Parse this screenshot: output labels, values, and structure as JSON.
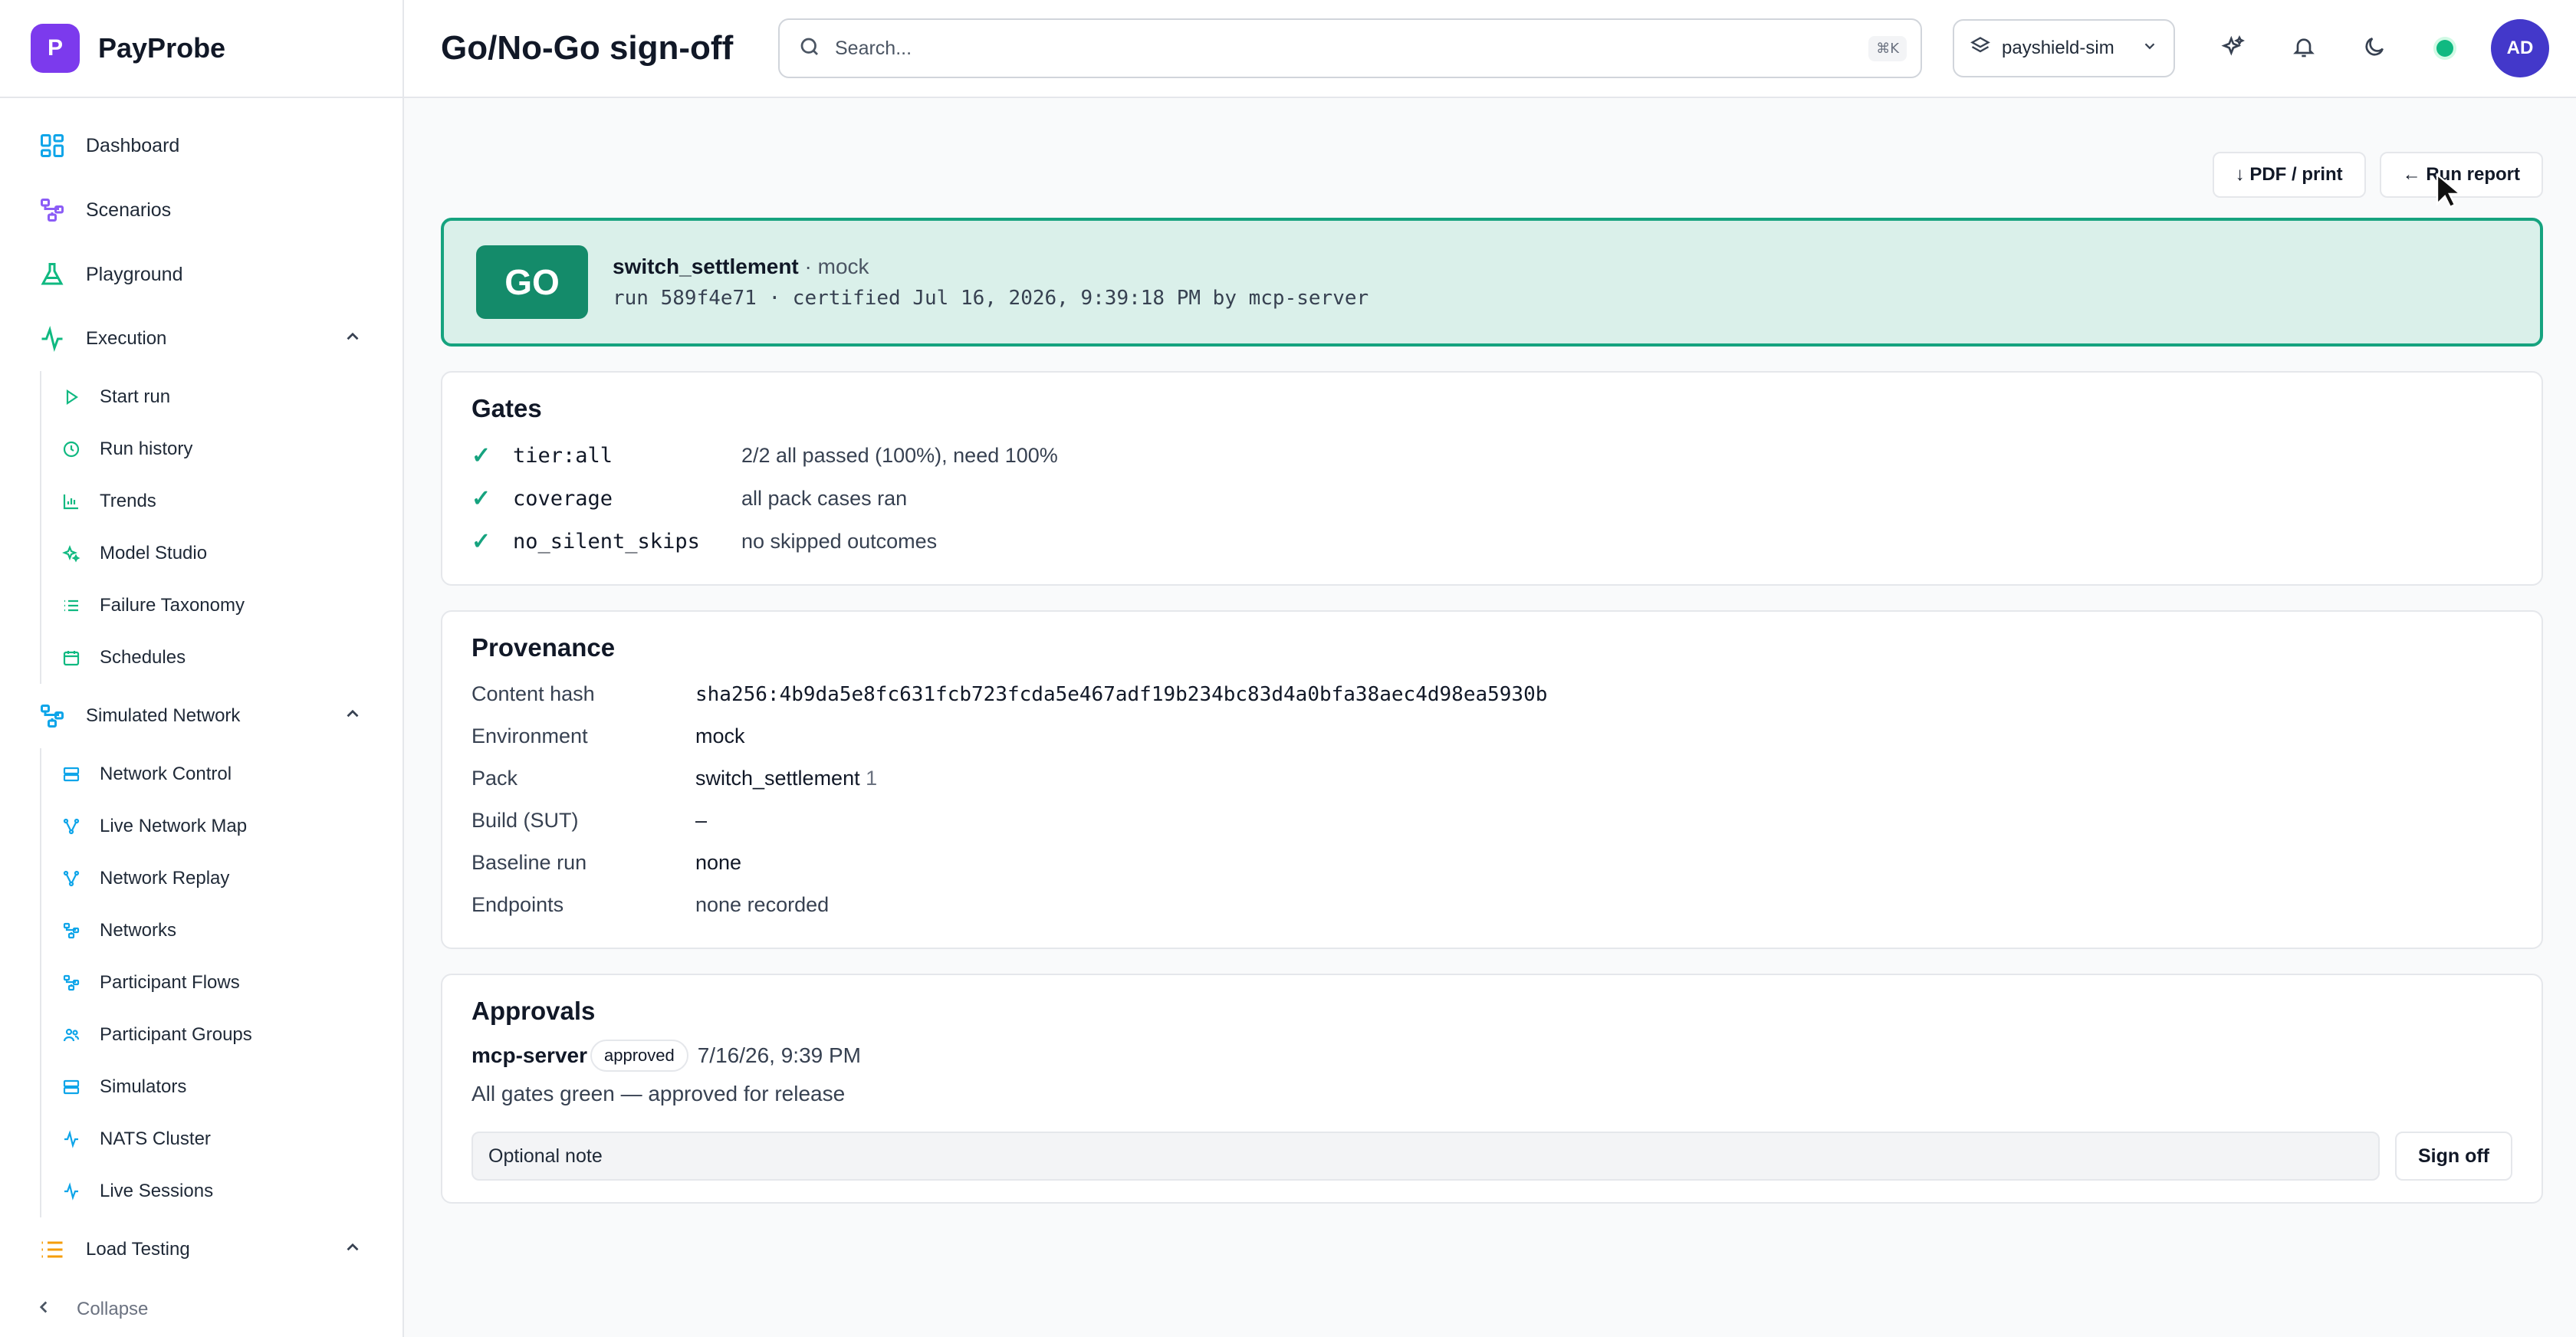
{
  "brand": {
    "logo_letter": "P",
    "name": "PayProbe"
  },
  "sidebar": {
    "top_items": [
      {
        "label": "Dashboard",
        "icon": "dashboard-icon"
      },
      {
        "label": "Scenarios",
        "icon": "scenarios-icon"
      },
      {
        "label": "Playground",
        "icon": "flask-icon"
      }
    ],
    "execution": {
      "label": "Execution",
      "items": [
        {
          "label": "Start run",
          "icon": "play-icon"
        },
        {
          "label": "Run history",
          "icon": "clock-icon"
        },
        {
          "label": "Trends",
          "icon": "bar-chart-icon"
        },
        {
          "label": "Model Studio",
          "icon": "sparkles-icon"
        },
        {
          "label": "Failure Taxonomy",
          "icon": "list-icon"
        },
        {
          "label": "Schedules",
          "icon": "calendar-icon"
        }
      ]
    },
    "simulated_network": {
      "label": "Simulated Network",
      "items": [
        {
          "label": "Network Control",
          "icon": "server-icon"
        },
        {
          "label": "Live Network Map",
          "icon": "network-icon"
        },
        {
          "label": "Network Replay",
          "icon": "network-icon"
        },
        {
          "label": "Networks",
          "icon": "workflow-icon"
        },
        {
          "label": "Participant Flows",
          "icon": "workflow-icon"
        },
        {
          "label": "Participant Groups",
          "icon": "users-icon"
        },
        {
          "label": "Simulators",
          "icon": "server-icon"
        },
        {
          "label": "NATS Cluster",
          "icon": "activity-icon"
        },
        {
          "label": "Live Sessions",
          "icon": "activity-icon"
        }
      ]
    },
    "load_testing": {
      "label": "Load Testing"
    },
    "collapse_label": "Collapse"
  },
  "header": {
    "title": "Go/No-Go sign-off",
    "search_placeholder": "Search...",
    "search_shortcut": "⌘K",
    "environment": "payshield-sim",
    "avatar_initials": "AD"
  },
  "actions": {
    "pdf_label": "↓ PDF / print",
    "run_report_label": "← Run report"
  },
  "verdict": {
    "badge": "GO",
    "pack": "switch_settlement",
    "env_suffix": "· mock",
    "detail": "run 589f4e71 · certified Jul 16, 2026, 9:39:18 PM by mcp-server"
  },
  "gates": {
    "title": "Gates",
    "rows": [
      {
        "check": "✓",
        "name": "tier:all",
        "detail": "2/2 all passed (100%), need 100%"
      },
      {
        "check": "✓",
        "name": "coverage",
        "detail": "all pack cases ran"
      },
      {
        "check": "✓",
        "name": "no_silent_skips",
        "detail": "no skipped outcomes"
      }
    ]
  },
  "provenance": {
    "title": "Provenance",
    "content_hash_label": "Content hash",
    "content_hash": "sha256:4b9da5e8fc631fcb723fcda5e467adf19b234bc83d4a0bfa38aec4d98ea5930b",
    "environment_label": "Environment",
    "environment": "mock",
    "pack_label": "Pack",
    "pack_name": "switch_settlement",
    "pack_version": "1",
    "build_label": "Build (SUT)",
    "build": "–",
    "baseline_label": "Baseline run",
    "baseline": "none",
    "endpoints_label": "Endpoints",
    "endpoints": "none recorded"
  },
  "approvals": {
    "title": "Approvals",
    "approver": "mcp-server",
    "status": "approved",
    "timestamp": "7/16/26, 9:39 PM",
    "note": "All gates green — approved for release",
    "note_placeholder": "Optional note",
    "signoff_label": "Sign off"
  },
  "colors": {
    "accent": "#7c3aed",
    "go_green": "#148b6a",
    "go_bg": "#daf0ea",
    "status_dot": "#10b981"
  }
}
